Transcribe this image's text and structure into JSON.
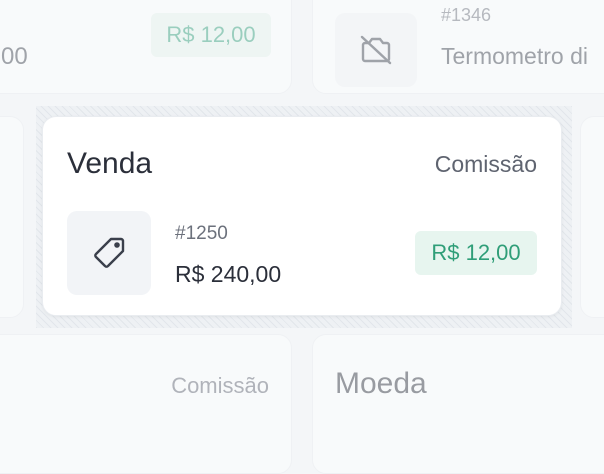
{
  "top_left_card": {
    "partial_value": "00",
    "commission": "R$ 12,00"
  },
  "top_right_card": {
    "order_id": "#1346",
    "product_name": "Termometro di"
  },
  "main_card": {
    "title": "Venda",
    "subtitle": "Comissão",
    "order_id": "#1250",
    "amount": "R$ 240,00",
    "commission": "R$ 12,00",
    "icon": "tag-icon"
  },
  "bottom_left_card": {
    "label": "Comissão"
  },
  "bottom_right_card": {
    "title": "Moeda"
  },
  "colors": {
    "accent_green": "#2f9e78",
    "badge_bg": "#e7f5ef",
    "background": "#f4f6f8"
  }
}
